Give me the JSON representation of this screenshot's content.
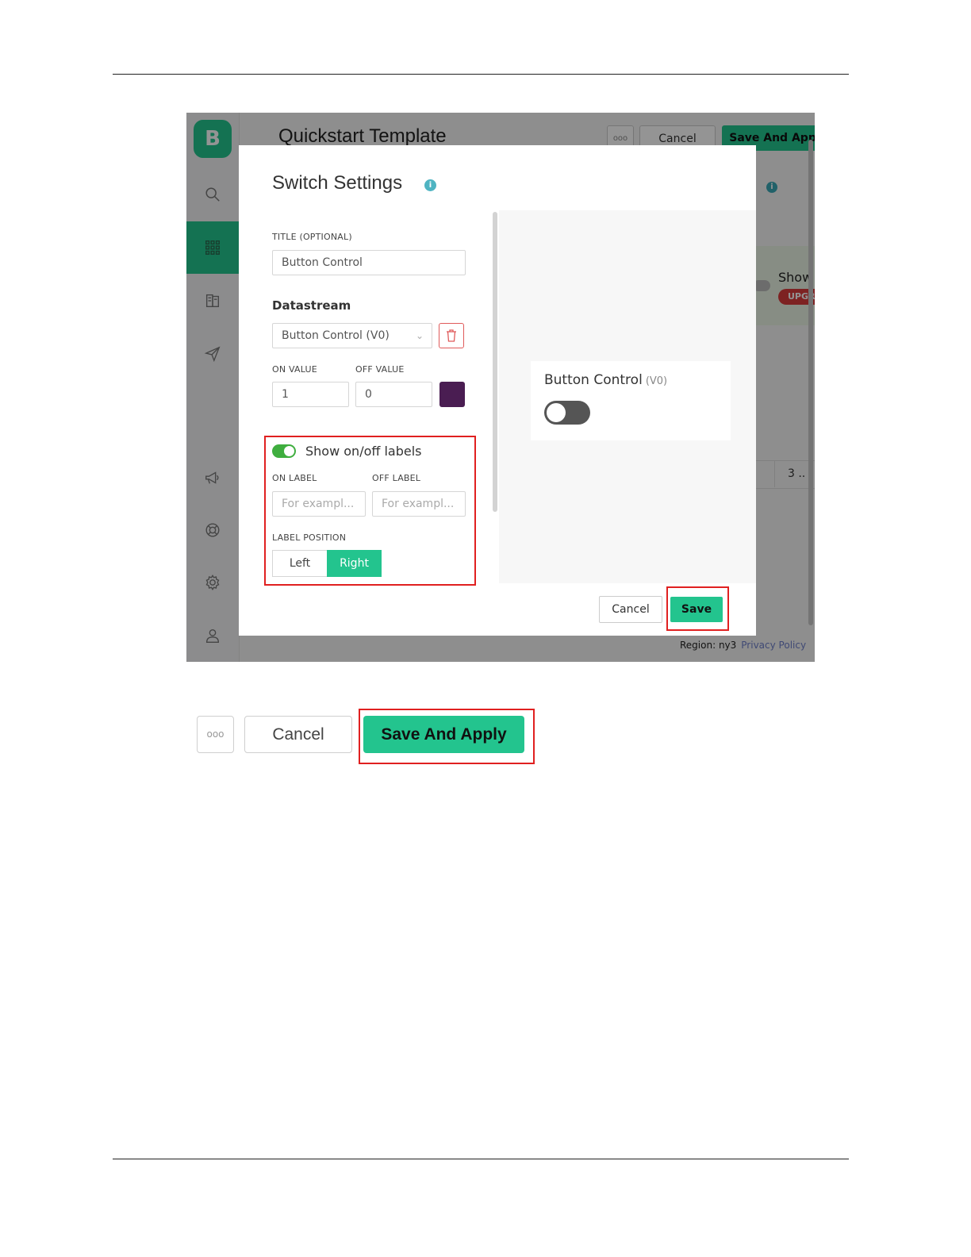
{
  "screenshot1": {
    "sidebar": {
      "logo_letter": "B",
      "icons": [
        "search-icon",
        "grid-icon",
        "library-icon",
        "send-icon",
        "megaphone-icon",
        "support-icon",
        "gear-icon",
        "user-icon"
      ]
    },
    "background": {
      "page_title": "Quickstart Template",
      "dots_label": "ooo",
      "cancel_label": "Cancel",
      "save_apply_label": "Save And Apply",
      "info_glyph": "i",
      "widget_card_label": "Show",
      "upgrade_badge": "UPGR",
      "table_cell": "3 ..",
      "footer": {
        "region": "Region: ny3",
        "privacy_link": "Privacy Policy"
      }
    },
    "modal": {
      "title": "Switch Settings",
      "info_glyph": "i",
      "title_field": {
        "label": "TITLE (OPTIONAL)",
        "value": "Button Control"
      },
      "datastream": {
        "label": "Datastream",
        "value": "Button Control (V0)"
      },
      "on_value": {
        "label": "ON VALUE",
        "value": "1"
      },
      "off_value": {
        "label": "OFF VALUE",
        "value": "0"
      },
      "color": "#4a1d52",
      "show_labels": {
        "label": "Show on/off labels",
        "enabled": true
      },
      "on_label": {
        "label": "ON LABEL",
        "placeholder": "For exampl..."
      },
      "off_label": {
        "label": "OFF LABEL",
        "placeholder": "For exampl..."
      },
      "label_position": {
        "label": "LABEL POSITION",
        "options": [
          "Left",
          "Right"
        ],
        "selected": "Right"
      },
      "preview": {
        "title": "Button Control",
        "subtitle": "(V0)",
        "switch_on": false
      },
      "cancel_label": "Cancel",
      "save_label": "Save"
    }
  },
  "screenshot2": {
    "dots_label": "ooo",
    "cancel_label": "Cancel",
    "save_apply_label": "Save And Apply"
  },
  "colors": {
    "accent": "#23c48e",
    "highlight": "#e02020",
    "danger": "#e05a5a"
  }
}
